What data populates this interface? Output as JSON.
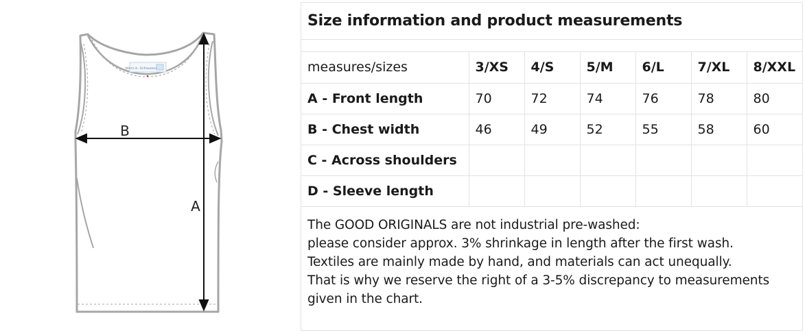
{
  "diagram": {
    "labels": {
      "a": "A",
      "b": "B"
    },
    "colors": {
      "garment": "#a6a6a6",
      "arrow": "#111111"
    }
  },
  "size_info": {
    "title": "Size information and product measurements",
    "corner_label": "measures/sizes",
    "sizes": [
      "3/XS",
      "4/S",
      "5/M",
      "6/L",
      "7/XL",
      "8/XXL"
    ],
    "rows": [
      {
        "label": "A - Front length",
        "values": [
          "70",
          "72",
          "74",
          "76",
          "78",
          "80"
        ]
      },
      {
        "label": "B - Chest width",
        "values": [
          "46",
          "49",
          "52",
          "55",
          "58",
          "60"
        ]
      },
      {
        "label": "C - Across shoulders",
        "values": [
          "",
          "",
          "",
          "",
          "",
          ""
        ]
      },
      {
        "label": "D - Sleeve length",
        "values": [
          "",
          "",
          "",
          "",
          "",
          ""
        ]
      }
    ],
    "notes": [
      "The GOOD ORIGINALS are not industrial pre-washed:",
      "please consider approx. 3% shrinkage in length after the first wash.",
      "Textiles are mainly made by hand, and materials can act unequally.",
      "That is why we reserve the right of a 3-5% discrepancy to measurements",
      "given in the chart."
    ],
    "colors": {
      "grid": "#e3e3e3",
      "text": "#1a1a1a"
    }
  }
}
